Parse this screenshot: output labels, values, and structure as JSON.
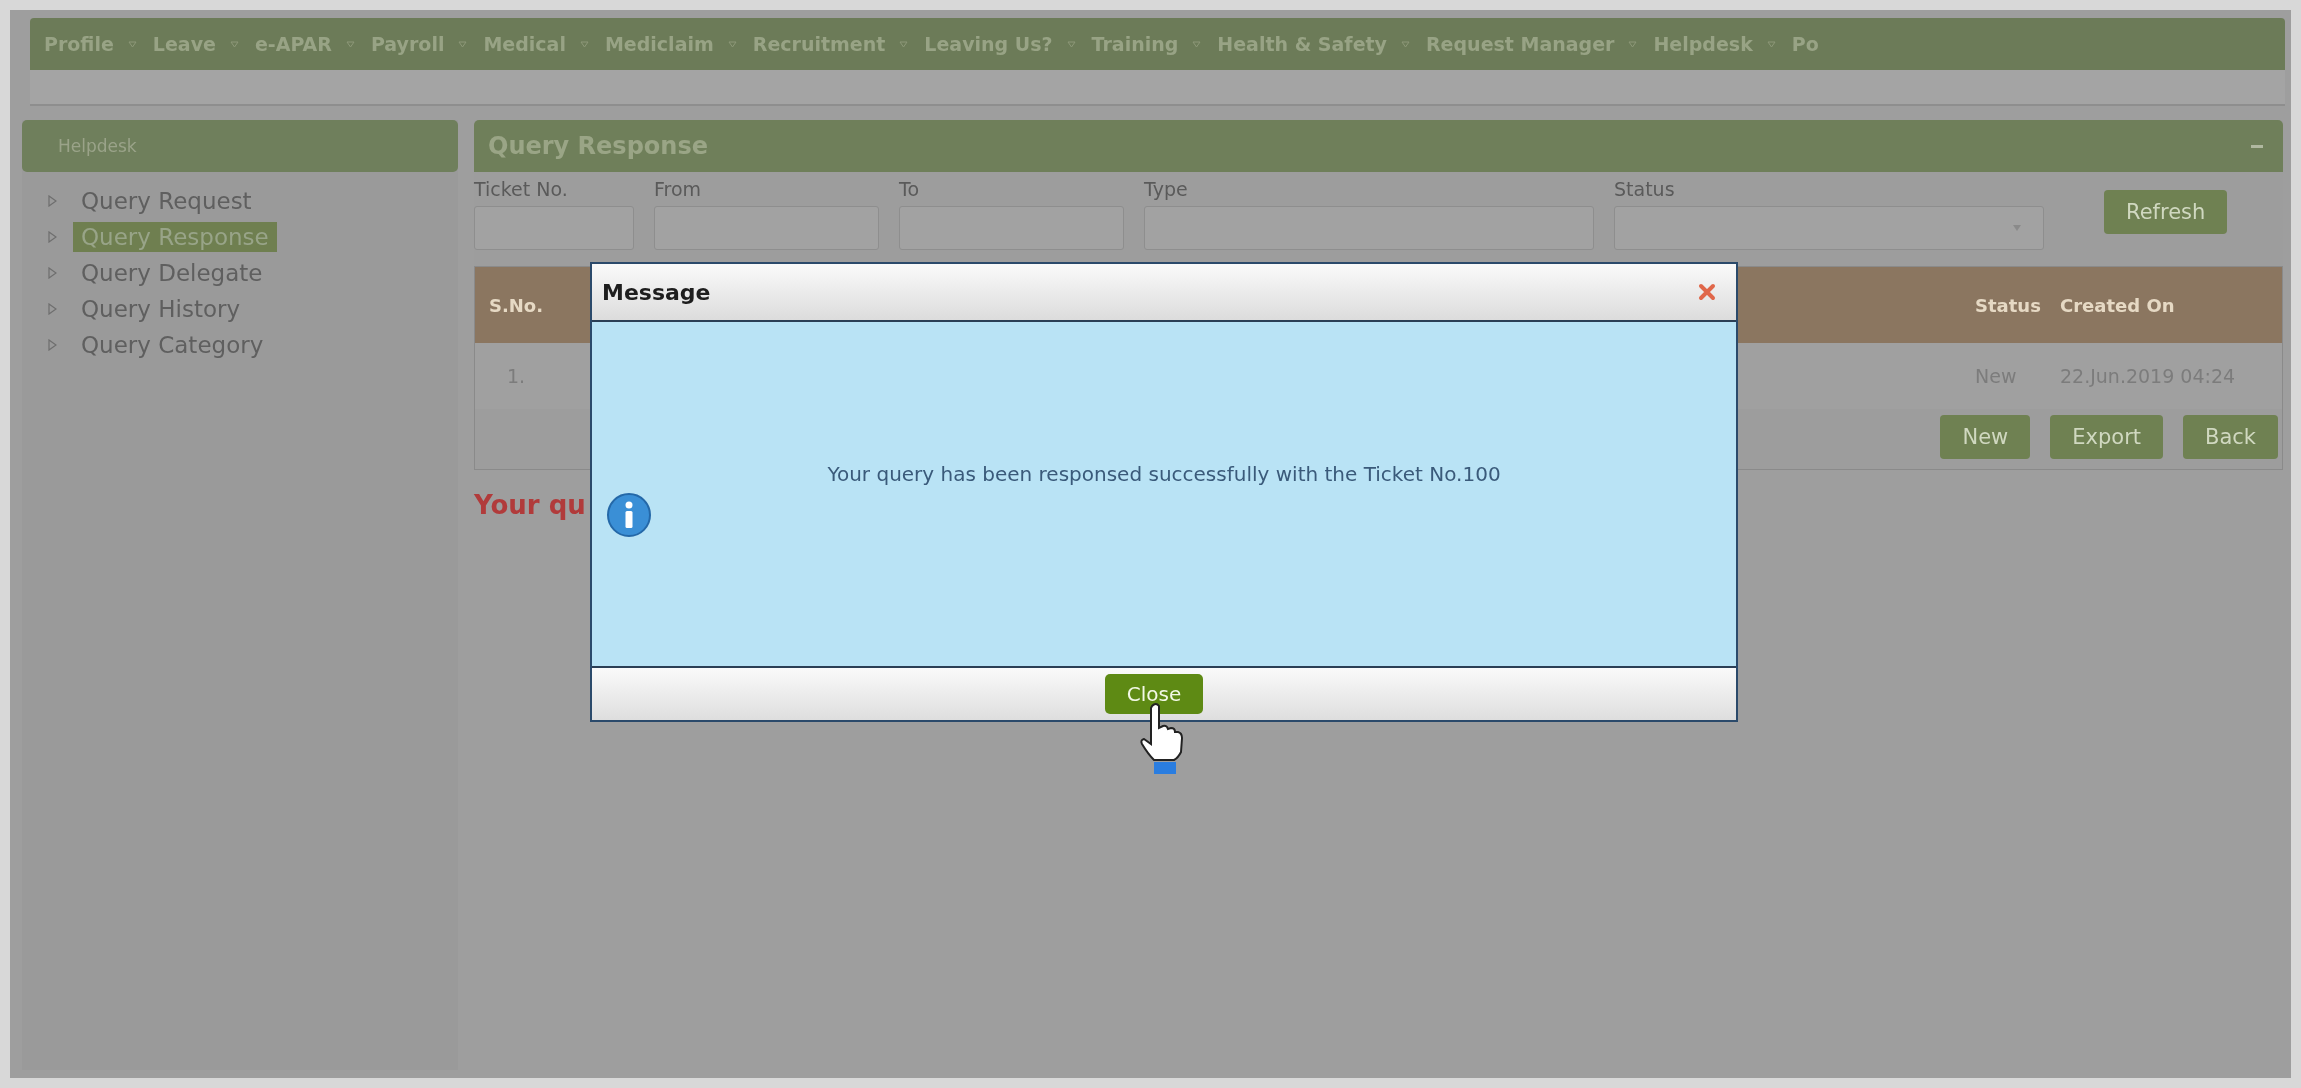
{
  "menu": [
    "Profile",
    "Leave",
    "e-APAR",
    "Payroll",
    "Medical",
    "Mediclaim",
    "Recruitment",
    "Leaving Us?",
    "Training",
    "Health & Safety",
    "Request Manager",
    "Helpdesk",
    "Po"
  ],
  "sidebar": {
    "title": "Helpdesk",
    "items": [
      {
        "label": "Query Request",
        "selected": false
      },
      {
        "label": "Query Response",
        "selected": true
      },
      {
        "label": "Query Delegate",
        "selected": false
      },
      {
        "label": "Query History",
        "selected": false
      },
      {
        "label": "Query Category",
        "selected": false
      }
    ]
  },
  "panel": {
    "title": "Query Response",
    "filters": {
      "ticket_label": "Ticket No.",
      "from_label": "From",
      "to_label": "To",
      "type_label": "Type",
      "status_label": "Status"
    },
    "refresh": "Refresh",
    "table": {
      "columns": [
        "S.No.",
        "Status",
        "Created On"
      ],
      "rows": [
        {
          "sno": "1.",
          "status": "New",
          "created": "22.Jun.2019 04:24"
        }
      ]
    },
    "buttons": [
      "New",
      "Export",
      "Back"
    ],
    "notice": "Your qu"
  },
  "dialog": {
    "title": "Message",
    "message": "Your query has been responsed successfully with the Ticket No.100",
    "button": "Close"
  }
}
